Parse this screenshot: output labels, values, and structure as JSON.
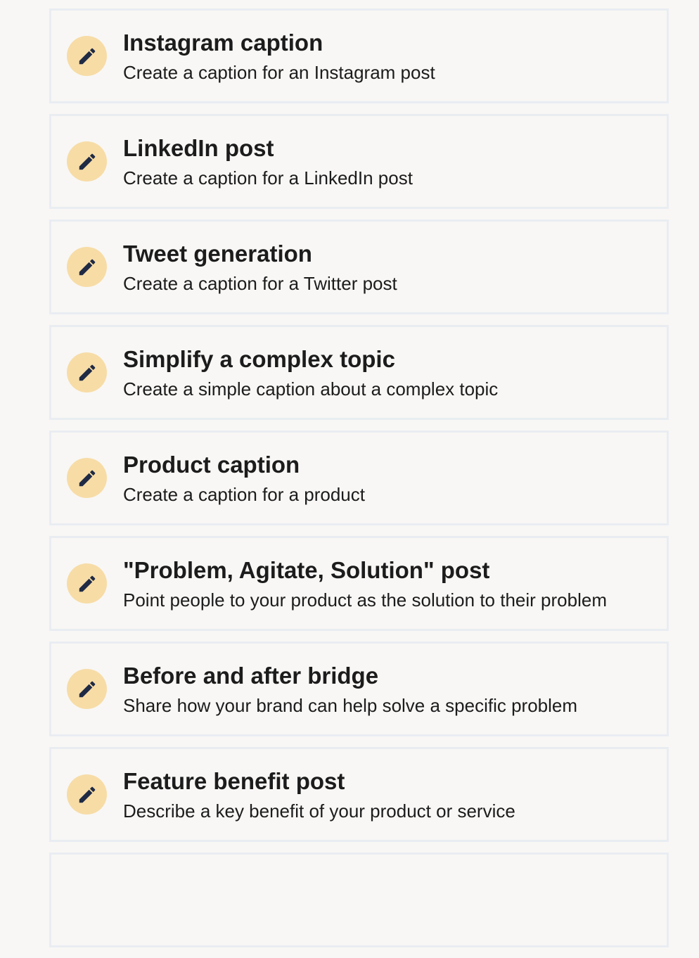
{
  "accent_color": "#f7dca6",
  "icon": "pencil-icon",
  "templates": [
    {
      "title": "",
      "description": ""
    },
    {
      "title": "Instagram caption",
      "description": "Create a caption for an Instagram post"
    },
    {
      "title": "LinkedIn post",
      "description": "Create a caption for a LinkedIn post"
    },
    {
      "title": "Tweet generation",
      "description": "Create a caption for a Twitter post"
    },
    {
      "title": "Simplify a complex topic",
      "description": "Create a simple caption about a complex topic"
    },
    {
      "title": "Product caption",
      "description": "Create a caption for a product"
    },
    {
      "title": "\"Problem, Agitate, Solution\" post",
      "description": "Point people to your product as the solution to their problem"
    },
    {
      "title": "Before and after bridge",
      "description": "Share how your brand can help solve a specific problem"
    },
    {
      "title": "Feature benefit post",
      "description": "Describe a key benefit of your product or service"
    },
    {
      "title": "",
      "description": ""
    }
  ]
}
